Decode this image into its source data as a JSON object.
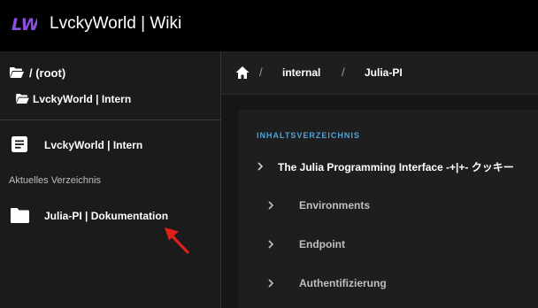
{
  "header": {
    "logo_text": "LW",
    "title": "LvckyWorld | Wiki"
  },
  "sidebar": {
    "root_label": "/ (root)",
    "parent_label": "LvckyWorld | Intern",
    "page_label": "LvckyWorld | Intern",
    "section_label": "Aktuelles Verzeichnis",
    "current_dir_label": "Julia-PI | Dokumentation"
  },
  "breadcrumb": {
    "separator": "/",
    "items": [
      "internal",
      "Julia-PI"
    ]
  },
  "toc": {
    "title": "INHALTSVERZEICHNIS",
    "top_item": "The Julia Programming Interface -+|+- クッキー",
    "sub_items": [
      "Environments",
      "Endpoint",
      "Authentifizierung"
    ]
  },
  "colors": {
    "header_bg": "#000000",
    "sidebar_bg": "#1b1b1b",
    "toc_accent": "#4fa3d6",
    "logo": "#8a4fe0",
    "annotation_arrow": "#e0201b"
  },
  "icons": {
    "logo": "lw-logo-icon",
    "root_folder": "folder-open-icon",
    "parent_folder": "folder-open-icon",
    "page": "document-icon",
    "current_dir": "folder-icon",
    "home": "home-icon",
    "toc_chevron": "chevron-right-icon",
    "pointer": "red-arrow-icon"
  }
}
